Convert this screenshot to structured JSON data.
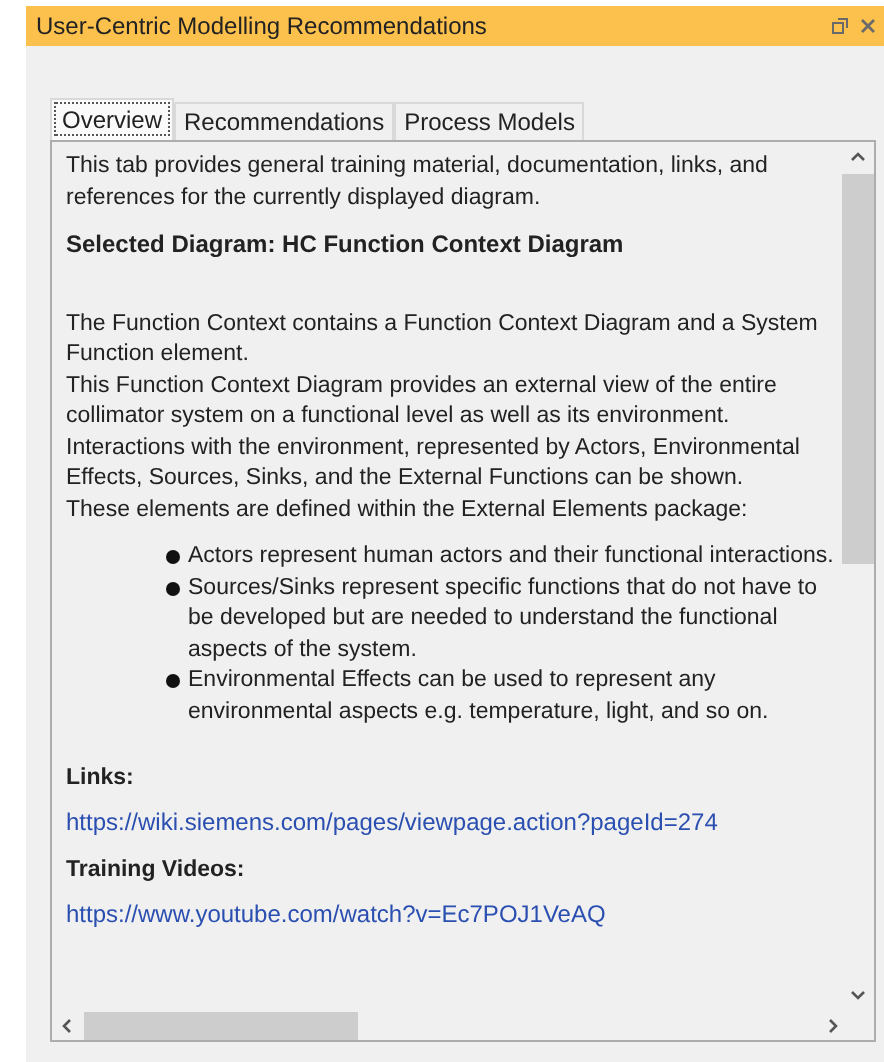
{
  "window": {
    "title": "User-Centric Modelling Recommendations"
  },
  "tabs": [
    {
      "label": "Overview",
      "selected": true
    },
    {
      "label": "Recommendations",
      "selected": false
    },
    {
      "label": "Process Models",
      "selected": false
    }
  ],
  "content": {
    "intro": "This tab provides general training material, documentation, links, and references for the currently displayed diagram.",
    "heading": "Selected Diagram: HC Function Context Diagram",
    "paragraphs": [
      "The Function Context contains a Function Context Diagram and a System Function element.",
      "This Function Context Diagram provides an external view of the entire collimator system on a functional level as well as its environment.",
      "Interactions with the environment, represented by Actors, Environmental Effects, Sources, Sinks, and the External Functions can be shown.",
      "These elements are defined within the External Elements package:"
    ],
    "bullets": [
      "Actors represent human actors and their functional interactions.",
      "Sources/Sinks represent specific functions that do not have to be developed but are needed to understand the functional aspects of the system.",
      "Environmental Effects can be used to represent any environmental aspects e.g. temperature, light, and so on."
    ],
    "links_heading": "Links:",
    "link": "https://wiki.siemens.com/pages/viewpage.action?pageId=274",
    "videos_heading": "Training Videos:",
    "video_link": "https://www.youtube.com/watch?v=Ec7POJ1VeAQ"
  }
}
